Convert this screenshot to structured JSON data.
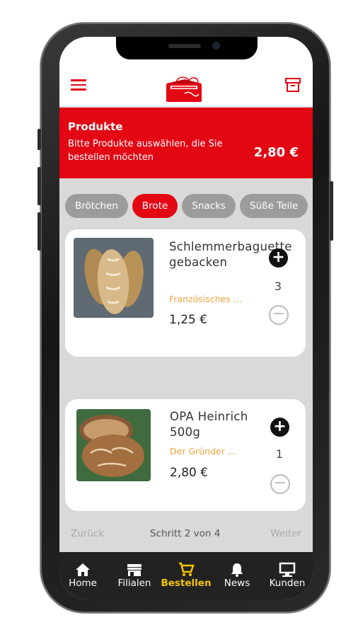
{
  "header": {
    "banner_title": "Produkte",
    "banner_subtitle": "Bitte Produkte auswählen, die Sie bestellen möchten",
    "total": "2,80 €"
  },
  "categories": [
    "Brötchen",
    "Brote",
    "Snacks",
    "Süße Teile"
  ],
  "active_category": "Brote",
  "products": [
    {
      "name": "Schlemmerbaguette gebacken",
      "desc": "Französisches ...",
      "qty": "3",
      "price": "1,25 €"
    },
    {
      "name": "OPA Heinrich 500g",
      "desc": "Der Gründer ...",
      "qty": "1",
      "price": "2,80 €"
    }
  ],
  "stepper": {
    "back": "Zurück",
    "step": "Schritt 2 von 4",
    "next": "Weiter"
  },
  "tabs": [
    {
      "label": "Home",
      "icon": "home-icon"
    },
    {
      "label": "Filialen",
      "icon": "store-icon"
    },
    {
      "label": "Bestellen",
      "icon": "cart-icon"
    },
    {
      "label": "News",
      "icon": "bell-icon"
    },
    {
      "label": "Kunden",
      "icon": "monitor-icon"
    }
  ],
  "active_tab": "Bestellen",
  "colors": {
    "brand_red": "#e30613",
    "highlight_yellow": "#f5c400",
    "desc_orange": "#f4a340"
  }
}
